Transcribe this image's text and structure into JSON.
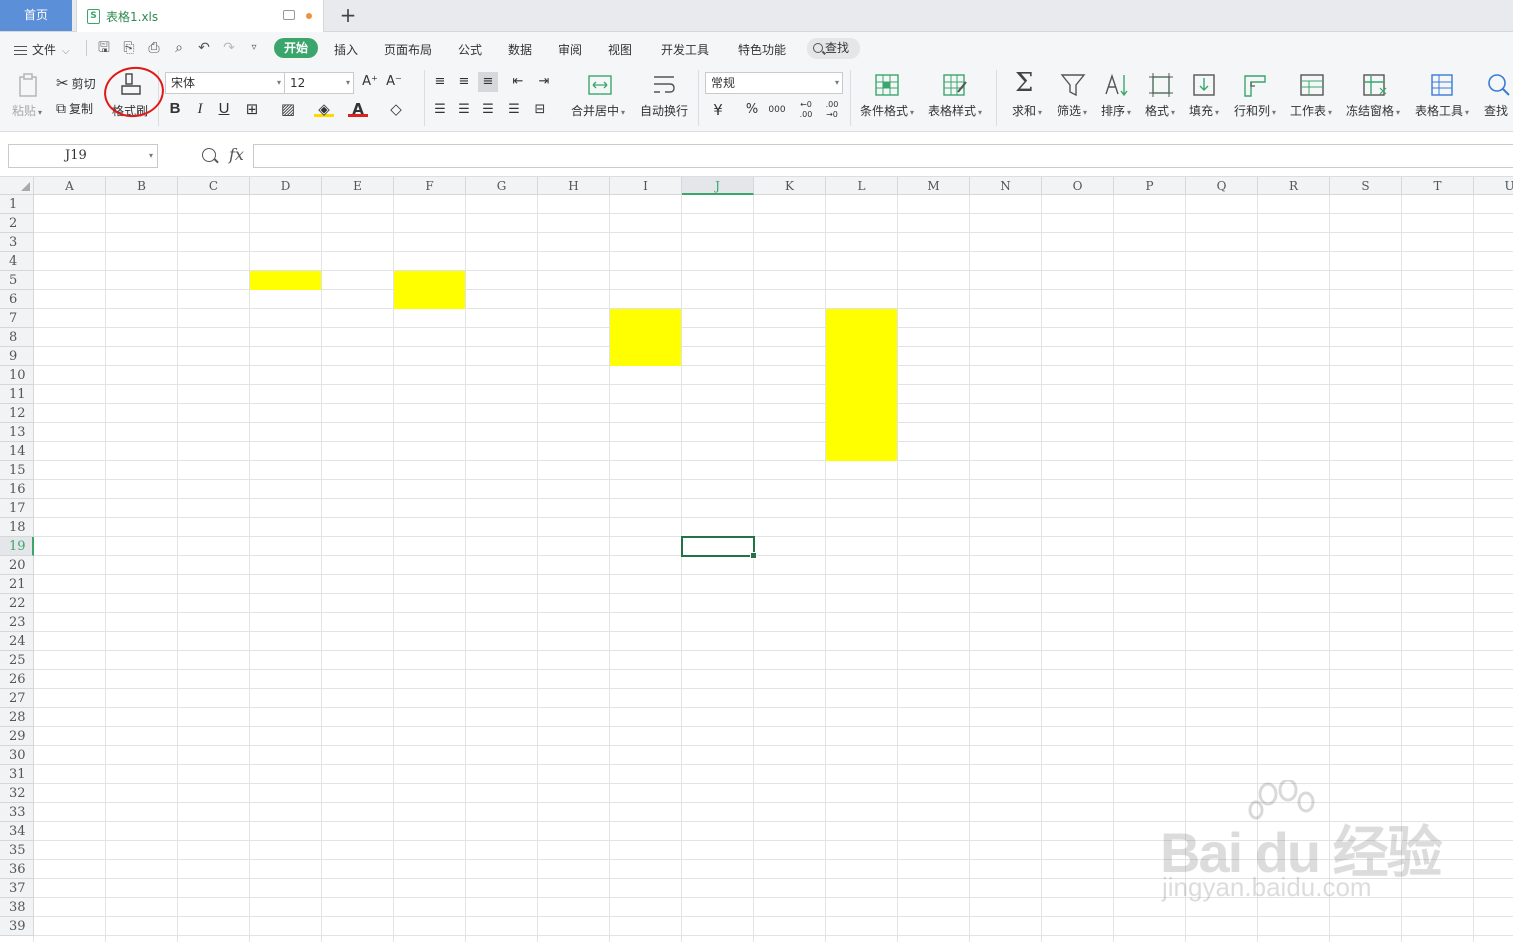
{
  "tabbar": {
    "home_label": "首页",
    "file_name": "表格1.xls",
    "new_tab_symbol": "+",
    "xls_icon_letter": "S"
  },
  "menu": {
    "file_label": "文件",
    "tabs": [
      "开始",
      "插入",
      "页面布局",
      "公式",
      "数据",
      "审阅",
      "视图",
      "开发工具",
      "特色功能"
    ],
    "active_tab": "开始",
    "search_label": "查找"
  },
  "ribbon": {
    "paste": "粘贴",
    "cut": "剪切",
    "copy": "复制",
    "format_painter": "格式刷",
    "font_name": "宋体",
    "font_size": "12",
    "number_format": "常规",
    "merge_center": "合并居中",
    "wrap_text": "自动换行",
    "conditional_format": "条件格式",
    "table_style": "表格样式",
    "sum": "求和",
    "filter": "筛选",
    "sort": "排序",
    "format": "格式",
    "fill": "填充",
    "rows_cols": "行和列",
    "worksheet": "工作表",
    "freeze_panes": "冻结窗格",
    "table_tools": "表格工具",
    "find": "查找",
    "bold": "B",
    "italic": "I",
    "underline": "U",
    "currency": "¥",
    "percent": "%",
    "thousands": "000",
    "inc_decimal": "←0 .00",
    "dec_decimal": ".00 →0",
    "font_grow": "A⁺",
    "font_shrink": "A⁻"
  },
  "formula_bar": {
    "name_box": "J19",
    "fx_label": "fx",
    "formula_value": ""
  },
  "sheet": {
    "columns": [
      "A",
      "B",
      "C",
      "D",
      "E",
      "F",
      "G",
      "H",
      "I",
      "J",
      "K",
      "L",
      "M",
      "N",
      "O",
      "P",
      "Q",
      "R",
      "S",
      "T",
      "U"
    ],
    "rows": [
      "1",
      "2",
      "3",
      "4",
      "5",
      "6",
      "7",
      "8",
      "9",
      "10",
      "11",
      "12",
      "13",
      "14",
      "15",
      "16",
      "17",
      "18",
      "19",
      "20",
      "21",
      "22",
      "23",
      "24",
      "25",
      "26",
      "27",
      "28",
      "29",
      "30",
      "31",
      "32",
      "33",
      "34",
      "35",
      "36",
      "37",
      "38",
      "39"
    ],
    "selected_cell": "J19",
    "fill_color": "#ffff00",
    "highlighted_ranges": [
      "D5",
      "F5:F6",
      "I7:I9",
      "L7:L14"
    ]
  },
  "watermark": {
    "brand": "Bai du 经验",
    "url": "jingyan.baidu.com"
  },
  "colors": {
    "accent": "#3aa66c",
    "home_tab": "#5b8fd8",
    "annotation_circle": "#e01818"
  }
}
